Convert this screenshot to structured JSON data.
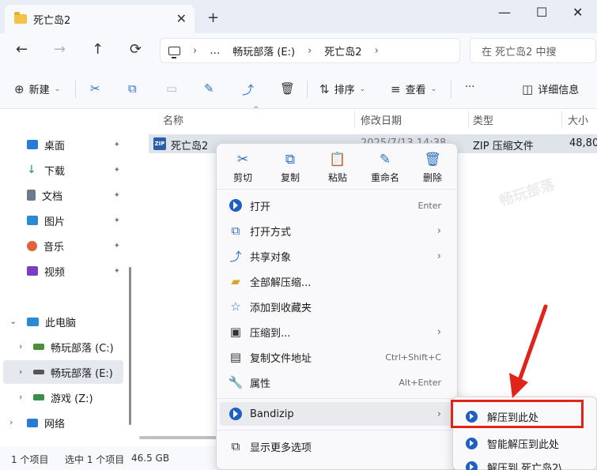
{
  "window": {
    "tab_title": "死亡岛2",
    "tab_close": "✕",
    "tab_new": "+",
    "minimize": "—",
    "maximize": "☐",
    "close": "✕"
  },
  "nav": {
    "back": "←",
    "forward": "→",
    "up": "↑",
    "refresh": "⟳",
    "breadcrumb": [
      "…",
      "畅玩部落 (E:)",
      "死亡岛2"
    ],
    "breadcrumb_sep": "›",
    "search_placeholder": "在 死亡岛2 中搜"
  },
  "toolbar": {
    "new_label": "新建",
    "sort_label": "排序",
    "view_label": "查看",
    "more": "···",
    "details_label": "详细信息"
  },
  "sidebar": {
    "quick": [
      {
        "label": "桌面",
        "color": "#2a7bd4"
      },
      {
        "label": "下载",
        "color": "#1f9a5a"
      },
      {
        "label": "文档",
        "color": "#6d7a8c"
      },
      {
        "label": "图片",
        "color": "#2a8bd4"
      },
      {
        "label": "音乐",
        "color": "#e0633d"
      },
      {
        "label": "视频",
        "color": "#7a3ec2"
      }
    ],
    "pin": "📌",
    "this_pc": "此电脑",
    "drives": [
      "畅玩部落 (C:)",
      "畅玩部落 (E:)",
      "游戏 (Z:)"
    ],
    "network": "网络"
  },
  "filelist": {
    "columns": [
      "名称",
      "修改日期",
      "类型",
      "大小"
    ],
    "file": {
      "name": "死亡岛2",
      "icon_text": "ZIP",
      "date": "2025/7/13 14:38",
      "type": "ZIP 压缩文件",
      "size": "48,80"
    }
  },
  "status": {
    "count": "1 个项目",
    "selected": "选中 1 个项目",
    "size": "46.5 GB"
  },
  "context_menu": {
    "top_buttons": [
      {
        "label": "剪切",
        "icon": "✂"
      },
      {
        "label": "复制",
        "icon": "⧉"
      },
      {
        "label": "粘贴",
        "icon": "📋"
      },
      {
        "label": "重命名",
        "icon": "✎"
      },
      {
        "label": "删除",
        "icon": "🗑"
      }
    ],
    "items": [
      {
        "label": "打开",
        "shortcut": "Enter"
      },
      {
        "label": "打开方式",
        "arrow": "›"
      },
      {
        "label": "共享对象",
        "arrow": "›"
      },
      {
        "label": "全部解压缩..."
      },
      {
        "label": "添加到收藏夹"
      },
      {
        "label": "压缩到...",
        "arrow": "›"
      },
      {
        "label": "复制文件地址",
        "shortcut": "Ctrl+Shift+C"
      },
      {
        "label": "属性",
        "shortcut": "Alt+Enter"
      },
      {
        "label": "Bandizip",
        "arrow": "›"
      },
      {
        "label": "显示更多选项"
      }
    ]
  },
  "submenu": {
    "items": [
      "解压到此处",
      "智能解压到此处",
      "解压到 死亡岛2\\"
    ]
  },
  "colors": {
    "accent": "#2f6fc3",
    "highlight": "#e0241b",
    "bandizip": "#1f5fbf"
  },
  "watermark": "畅玩部落"
}
